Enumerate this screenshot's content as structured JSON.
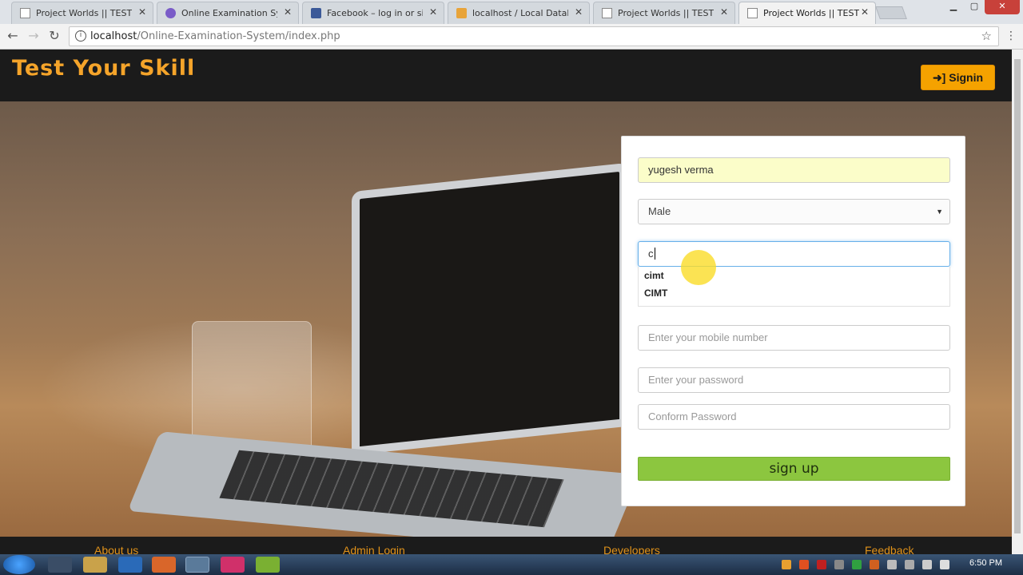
{
  "browser": {
    "tabs": [
      {
        "label": "Project Worlds || TEST YOUR SKILL",
        "active": false
      },
      {
        "label": "Online Examination System",
        "active": false
      },
      {
        "label": "Facebook – log in or sign up",
        "active": false
      },
      {
        "label": "localhost / Local Databases",
        "active": false
      },
      {
        "label": "Project Worlds || TEST YOUR SKILL",
        "active": false
      },
      {
        "label": "Project Worlds || TEST YOUR SKILL",
        "active": true
      }
    ],
    "url_host": "localhost",
    "url_path": "/Online-Examination-System/index.php"
  },
  "header": {
    "brand": "Test Your Skill",
    "signin_label": "Signin"
  },
  "form": {
    "name_value": "yugesh verma",
    "gender_value": "Male",
    "college_value": "c",
    "autocomplete": [
      "cimt",
      "CIMT"
    ],
    "mobile_placeholder": "Enter your mobile number",
    "password_placeholder": "Enter your password",
    "confirm_placeholder": "Conform Password",
    "signup_label": "sign up"
  },
  "footer": {
    "about": "About us",
    "admin": "Admin Login",
    "developers": "Developers",
    "feedback": "Feedback"
  },
  "taskbar": {
    "clock": "6:50 PM"
  },
  "colors": {
    "brand": "#f5a42a",
    "signin_bg": "#f5a200",
    "signup_bg": "#8cc63f"
  }
}
